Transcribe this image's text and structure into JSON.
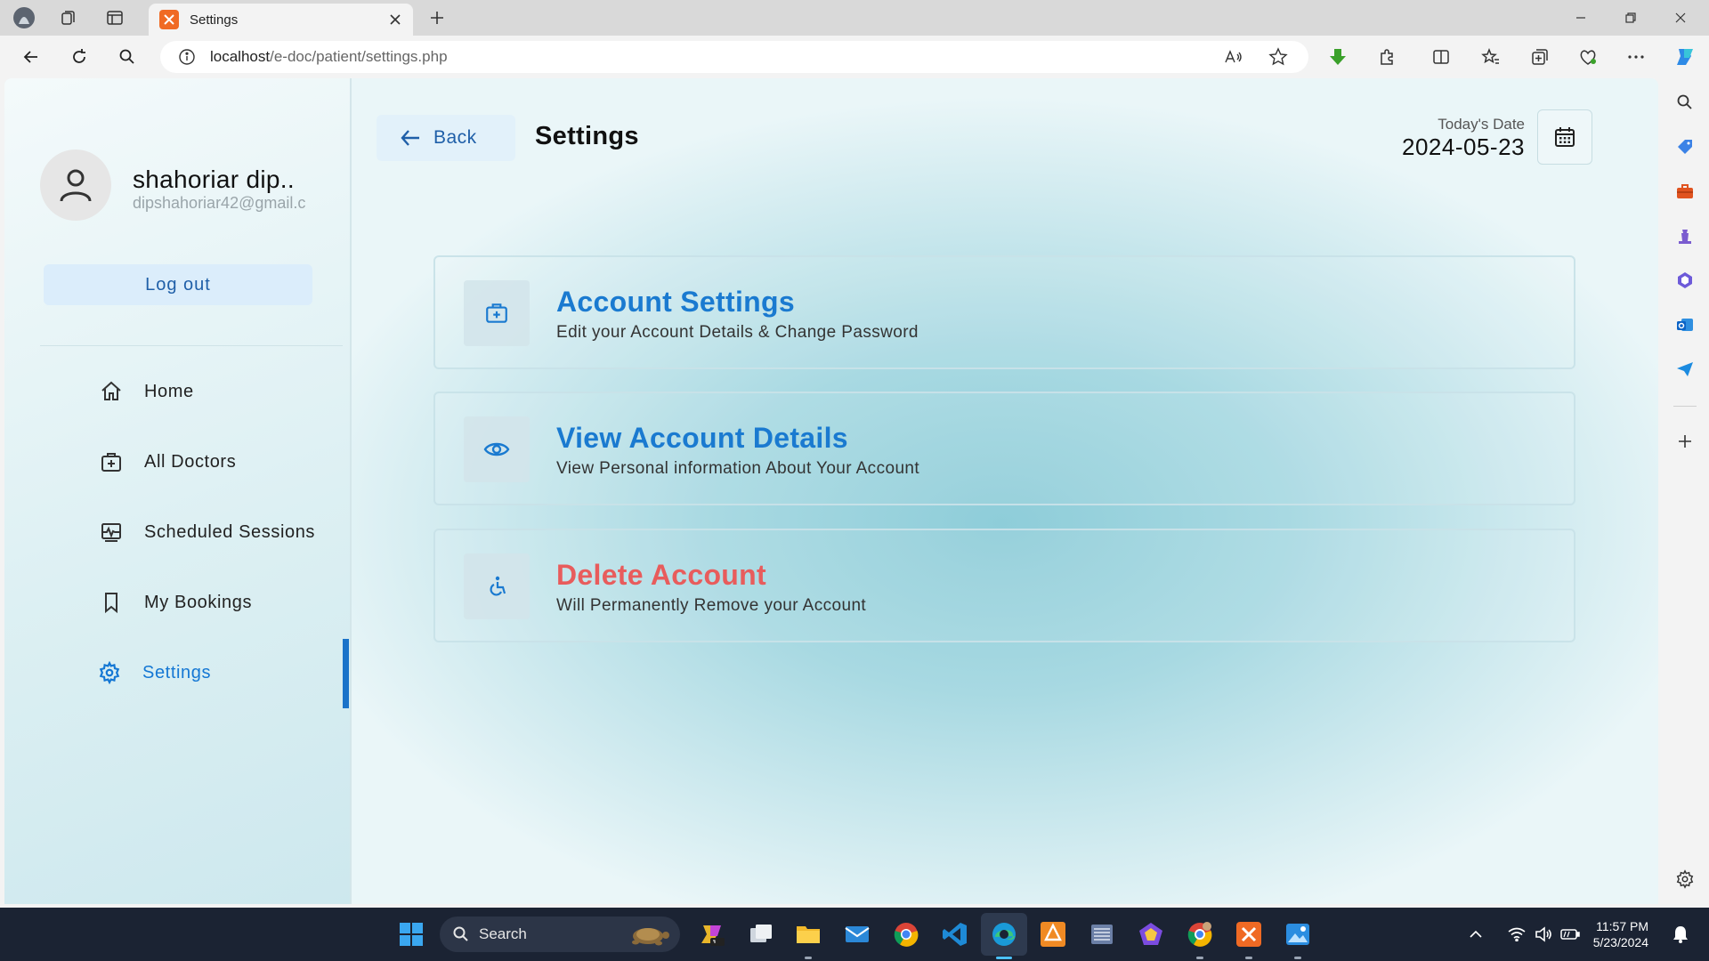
{
  "browser": {
    "tab_title": "Settings",
    "url_host": "localhost",
    "url_path": "/e-doc/patient/settings.php"
  },
  "sidebar": {
    "profile_name": "shahoriar dip..",
    "profile_email": "dipshahoriar42@gmail.c",
    "logout_label": "Log out",
    "items": [
      {
        "label": "Home",
        "icon": "home-icon"
      },
      {
        "label": "All Doctors",
        "icon": "medical-bag-icon"
      },
      {
        "label": "Scheduled Sessions",
        "icon": "schedule-icon"
      },
      {
        "label": "My Bookings",
        "icon": "bookmark-icon"
      },
      {
        "label": "Settings",
        "icon": "gear-icon",
        "active": true
      }
    ]
  },
  "header": {
    "back_label": "Back",
    "title": "Settings",
    "date_label": "Today's Date",
    "date_value": "2024-05-23"
  },
  "cards": [
    {
      "title": "Account Settings",
      "description": "Edit your Account Details & Change Password",
      "icon": "medical-bag-icon"
    },
    {
      "title": "View Account Details",
      "description": "View Personal information About Your Account",
      "icon": "eye-icon"
    },
    {
      "title": "Delete Account",
      "description": "Will Permanently Remove your Account",
      "icon": "accessibility-icon",
      "danger": true
    }
  ],
  "taskbar": {
    "search_label": "Search",
    "time": "11:57 PM",
    "date": "5/23/2024"
  },
  "colors": {
    "accent": "#1a7ad0",
    "danger": "#e85c5c",
    "active_bar": "#1a73c9"
  }
}
